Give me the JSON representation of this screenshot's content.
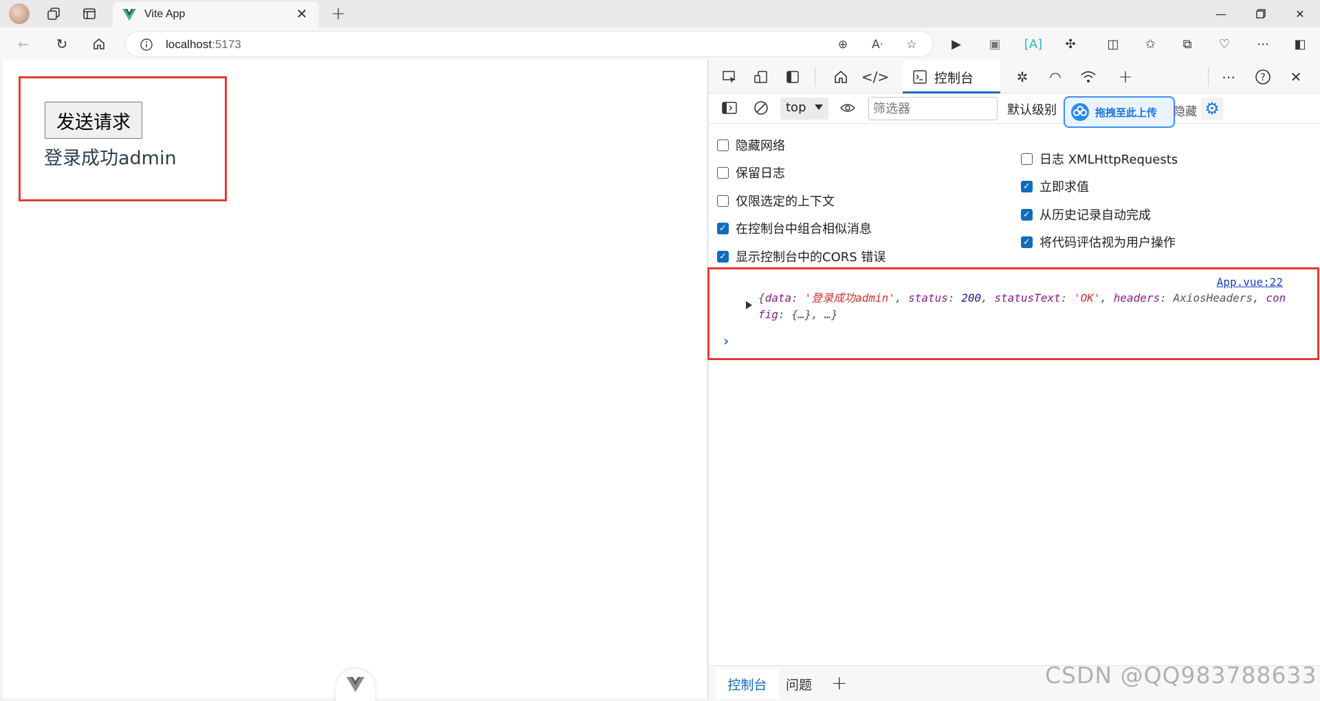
{
  "browser": {
    "tab_title": "Vite App",
    "url_host": "localhost",
    "url_port": ":5173",
    "icons": [
      "avatar",
      "collections-icon",
      "tab-actions-icon",
      "vue-logo-icon",
      "close-icon",
      "plus-icon",
      "minimize-icon",
      "restore-icon",
      "close-window-icon",
      "back-icon",
      "refresh-icon",
      "home-icon",
      "info-icon",
      "zoom-icon",
      "read-aloud-icon",
      "favorite-icon",
      "play-icon",
      "extension-icon",
      "translate-icon",
      "puzzle-icon",
      "split-screen-icon",
      "favorites-icon",
      "collections-icon",
      "performance-icon",
      "more-icon",
      "sidebar-icon"
    ]
  },
  "page": {
    "send_button_label": "发送请求",
    "result_text": "登录成功admin"
  },
  "devtools": {
    "console_tab_label": "控制台",
    "context_value": "top",
    "filter_placeholder": "筛选器",
    "level_label": "默认级别",
    "upload_badge_text": "拖拽至此上传",
    "hidden_label": "隐藏",
    "options_left": [
      {
        "label": "隐藏网络",
        "checked": false
      },
      {
        "label": "保留日志",
        "checked": false
      },
      {
        "label": "仅限选定的上下文",
        "checked": false
      },
      {
        "label": "在控制台中组合相似消息",
        "checked": true
      },
      {
        "label": "显示控制台中的CORS 错误",
        "checked": true
      }
    ],
    "options_right": [
      {
        "label": "日志 XMLHttpRequests",
        "checked": false
      },
      {
        "label": "立即求值",
        "checked": true
      },
      {
        "label": "从历史记录自动完成",
        "checked": true
      },
      {
        "label": "将代码评估视为用户操作",
        "checked": true
      }
    ],
    "log": {
      "source": "App.vue:22",
      "brace_open": "{",
      "k_data": "data",
      "v_data": "'登录成功admin'",
      "k_status": "status",
      "v_status": "200",
      "k_statusText": "statusText",
      "v_statusText": "'OK'",
      "k_headers": "headers",
      "v_headers": "AxiosHeaders",
      "k_config": "config",
      "v_config": "{…}",
      "tail": ", …}"
    },
    "drawer_console_label": "控制台",
    "drawer_issues_label": "问题"
  },
  "watermark": "CSDN @QQ983788633",
  "colors": {
    "highlight": "#e53935",
    "accent": "#0f6cbd",
    "string": "#d12f2f",
    "number": "#1a1aa6",
    "key": "#8b1a8b"
  }
}
